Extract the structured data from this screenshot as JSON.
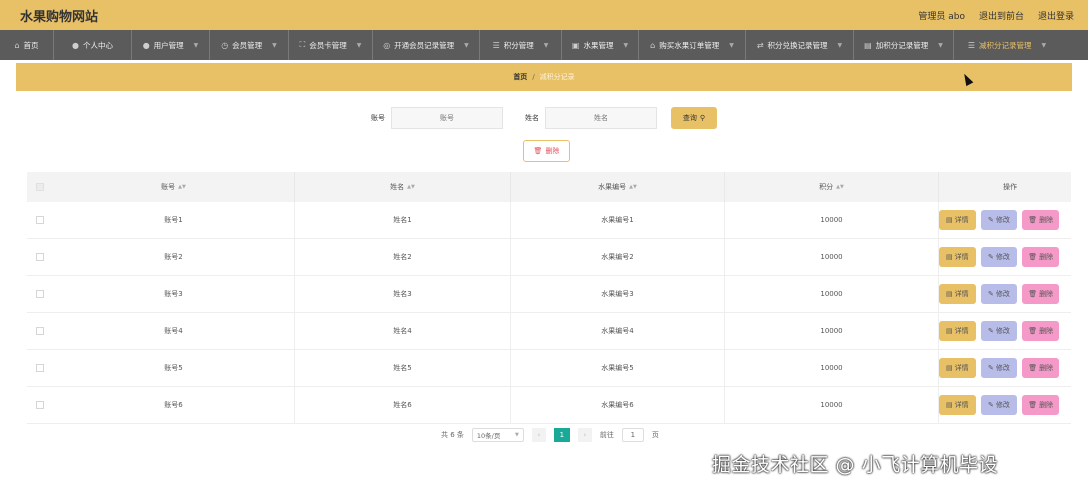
{
  "header": {
    "site_title": "水果购物网站",
    "user_label": "管理员 abo",
    "back_link": "退出到前台",
    "logout_link": "退出登录"
  },
  "nav": {
    "items": [
      {
        "label": "首页",
        "icon": "home-icon"
      },
      {
        "label": "个人中心",
        "icon": "user-icon"
      },
      {
        "label": "用户管理",
        "icon": "user-icon"
      },
      {
        "label": "会员管理",
        "icon": "clock-icon"
      },
      {
        "label": "会员卡管理",
        "icon": "card-icon"
      },
      {
        "label": "开通会员记录管理",
        "icon": "record-icon"
      },
      {
        "label": "积分管理",
        "icon": "list-icon"
      },
      {
        "label": "水果管理",
        "icon": "box-icon"
      },
      {
        "label": "购买水果订单管理",
        "icon": "bank-icon"
      },
      {
        "label": "积分兑换记录管理",
        "icon": "exchange-icon"
      },
      {
        "label": "加积分记录管理",
        "icon": "doc-icon"
      },
      {
        "label": "减积分记录管理",
        "icon": "list-icon"
      }
    ]
  },
  "breadcrumb": {
    "home": "首页",
    "separator": "/",
    "current": "减积分记录"
  },
  "search": {
    "account_label": "账号",
    "account_placeholder": "账号",
    "name_label": "姓名",
    "name_placeholder": "姓名",
    "query_label": "查询"
  },
  "actions": {
    "delete_label": "删除"
  },
  "table": {
    "headers": {
      "account": "账号",
      "name": "姓名",
      "fruit_no": "水果编号",
      "points": "积分",
      "ops": "操作"
    },
    "rows": [
      {
        "account": "账号1",
        "name": "姓名1",
        "fruit_no": "水果编号1",
        "points": "10000"
      },
      {
        "account": "账号2",
        "name": "姓名2",
        "fruit_no": "水果编号2",
        "points": "10000"
      },
      {
        "account": "账号3",
        "name": "姓名3",
        "fruit_no": "水果编号3",
        "points": "10000"
      },
      {
        "account": "账号4",
        "name": "姓名4",
        "fruit_no": "水果编号4",
        "points": "10000"
      },
      {
        "account": "账号5",
        "name": "姓名5",
        "fruit_no": "水果编号5",
        "points": "10000"
      },
      {
        "account": "账号6",
        "name": "姓名6",
        "fruit_no": "水果编号6",
        "points": "10000"
      }
    ],
    "row_buttons": {
      "detail": "详情",
      "edit": "修改",
      "delete": "删除"
    }
  },
  "pagination": {
    "total": "共 6 条",
    "page_size": "10条/页",
    "current_page": "1",
    "goto_label": "前往",
    "goto_value": "1",
    "page_unit": "页"
  },
  "watermark": "掘金技术社区 @ 小飞计算机毕设",
  "colors": {
    "accent": "#e8c066",
    "nav_bg": "#5c5b5b",
    "edit_btn": "#b7bde8",
    "delete_btn": "#f59ac8",
    "pager_active": "#18a999"
  }
}
